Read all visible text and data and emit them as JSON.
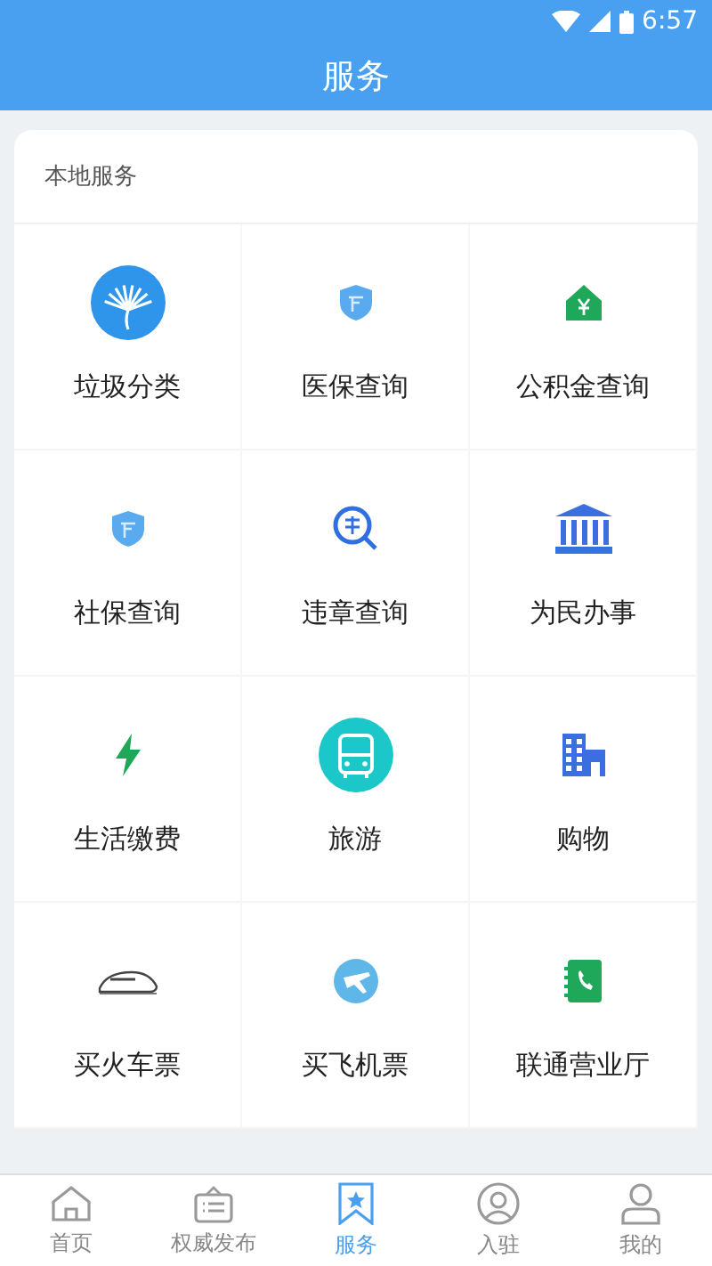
{
  "status_bar": {
    "time": "6:57"
  },
  "header": {
    "title": "服务"
  },
  "section": {
    "title": "本地服务",
    "items": [
      {
        "label": "垃圾分类"
      },
      {
        "label": "医保查询"
      },
      {
        "label": "公积金查询"
      },
      {
        "label": "社保查询"
      },
      {
        "label": "违章查询"
      },
      {
        "label": "为民办事"
      },
      {
        "label": "生活缴费"
      },
      {
        "label": "旅游"
      },
      {
        "label": "购物"
      },
      {
        "label": "买火车票"
      },
      {
        "label": "买飞机票"
      },
      {
        "label": "联通营业厅"
      }
    ]
  },
  "tab_bar": [
    {
      "label": "首页",
      "selected": false
    },
    {
      "label": "权威发布",
      "selected": false
    },
    {
      "label": "服务",
      "selected": true
    },
    {
      "label": "入驻",
      "selected": false
    },
    {
      "label": "我的",
      "selected": false
    }
  ]
}
